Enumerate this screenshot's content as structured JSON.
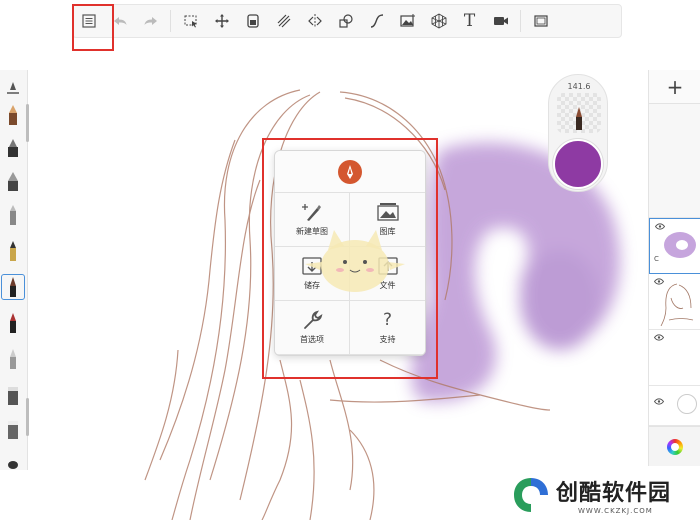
{
  "toolbar": {
    "items": [
      {
        "name": "menu-list-icon"
      },
      {
        "name": "undo-icon",
        "disabled": true
      },
      {
        "name": "redo-icon",
        "disabled": true
      },
      {
        "name": "selection-icon"
      },
      {
        "name": "transform-move-icon"
      },
      {
        "name": "layer-fill-icon"
      },
      {
        "name": "ruler-icon"
      },
      {
        "name": "symmetry-icon"
      },
      {
        "name": "shape-icon"
      },
      {
        "name": "curve-icon"
      },
      {
        "name": "image-insert-icon"
      },
      {
        "name": "perspective-grid-icon"
      },
      {
        "name": "text-tool-icon",
        "label": "T"
      },
      {
        "name": "video-record-icon"
      },
      {
        "name": "fullscreen-icon"
      }
    ]
  },
  "brush_puck": {
    "size_value": "141.6",
    "color": "#8e3aa3"
  },
  "layer_panel": {
    "add_label": "+",
    "layer1_tag": "C"
  },
  "main_menu": {
    "items": [
      {
        "id": "new-sketch",
        "label": "新建草图",
        "icon": "new-sketch-icon"
      },
      {
        "id": "gallery",
        "label": "图库",
        "icon": "gallery-icon"
      },
      {
        "id": "save",
        "label": "储存",
        "icon": "save-icon"
      },
      {
        "id": "file",
        "label": "文件",
        "icon": "file-icon"
      },
      {
        "id": "preferences",
        "label": "首选项",
        "icon": "wrench-icon"
      },
      {
        "id": "support",
        "label": "支持",
        "icon": "question-icon",
        "glyph": "?"
      }
    ]
  },
  "watermark": {
    "name": "创酷软件园",
    "url": "WWW.CKZKJ.COM"
  },
  "colors": {
    "highlight": "#e0312c",
    "accent_purple": "#8e3aa3",
    "selection_blue": "#4a90d9"
  }
}
